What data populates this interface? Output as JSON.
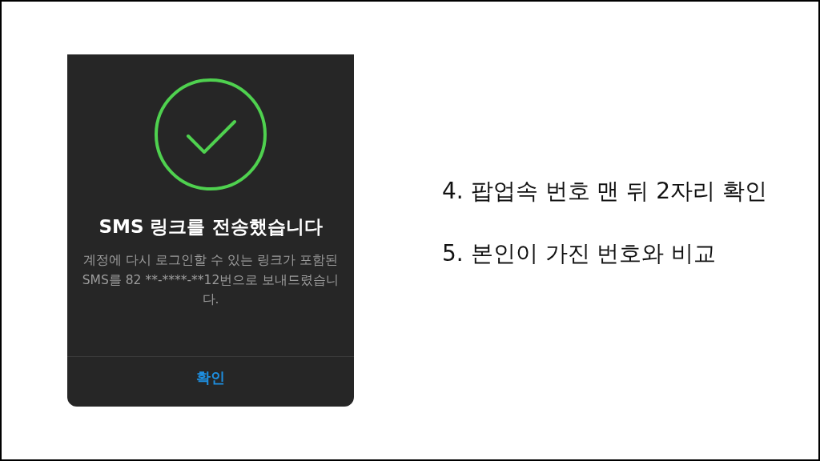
{
  "dialog": {
    "title": "SMS 링크를 전송했습니다",
    "message": "계정에 다시 로그인할 수 있는 링크가 포함된 SMS를 82 **-****-**12번으로 보내드렸습니다.",
    "button": "확인"
  },
  "steps": [
    "4. 팝업속 번호 맨 뒤 2자리 확인",
    "5. 본인이 가진 번호와 비교"
  ]
}
